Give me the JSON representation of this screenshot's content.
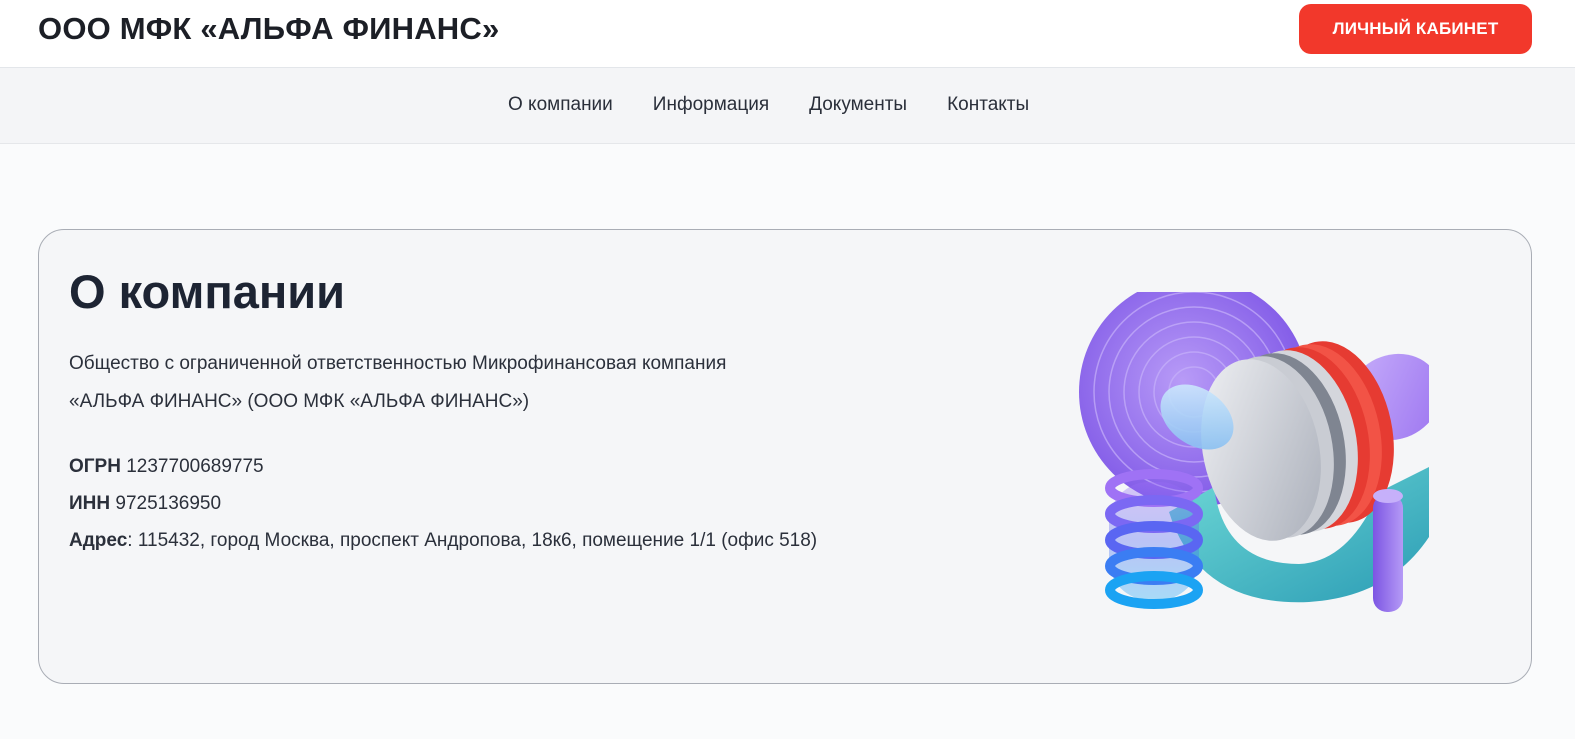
{
  "header": {
    "brand": "ООО МФК «АЛЬФА ФИНАНС»",
    "cabinet_button": "ЛИЧНЫЙ КАБИНЕТ"
  },
  "nav": {
    "items": [
      "О компании",
      "Информация",
      "Документы",
      "Контакты"
    ]
  },
  "about": {
    "title": "О компании",
    "description_line1": "Общество с ограниченной ответственностью Микрофинансовая компания",
    "description_line2": "«АЛЬФА ФИНАНС» (ООО МФК «АЛЬФА ФИНАНС»)",
    "ogrn_label": "ОГРН",
    "ogrn_value": "1237700689775",
    "inn_label": "ИНН",
    "inn_value": "9725136950",
    "address_label": "Адрес",
    "address_value": ": 115432, город Москва, проспект Андропова, 18к6, помещение 1/1 (офис 518)"
  },
  "colors": {
    "accent": "#f2382b",
    "heading": "#1d2433",
    "nav_bg": "#f4f5f7"
  }
}
